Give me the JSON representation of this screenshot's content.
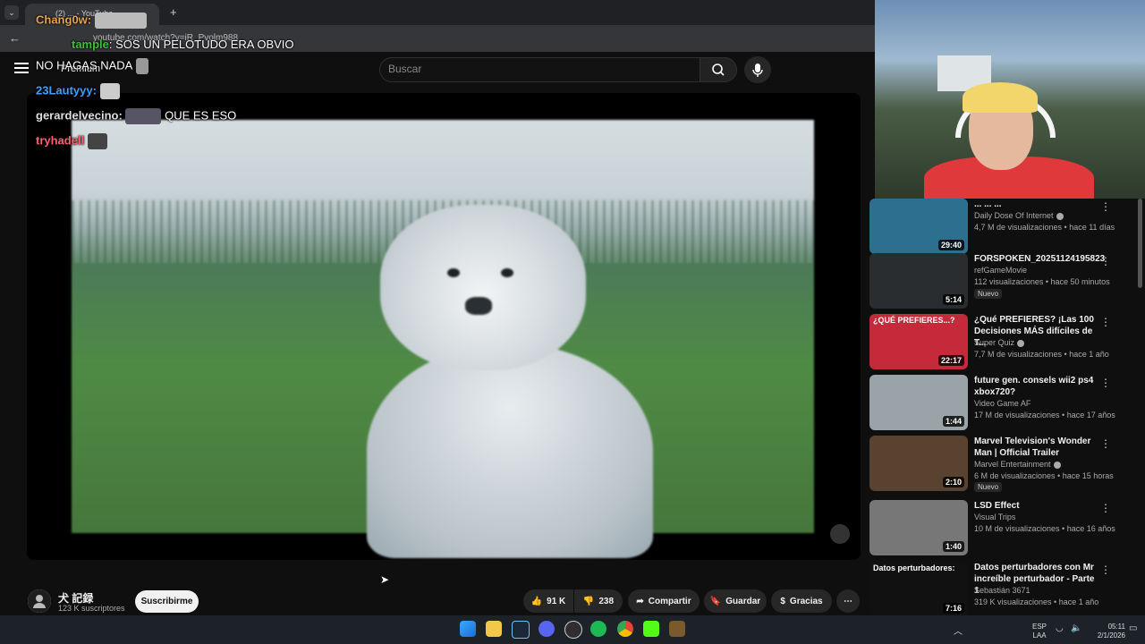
{
  "browser": {
    "tab_title": "(2) ... - YouTube",
    "url": "youtube.com/watch?v=iR_Pvolm988"
  },
  "search": {
    "placeholder": "Buscar"
  },
  "chat": [
    {
      "user": "Chang0w:",
      "color": "#e8a64a",
      "message": ""
    },
    {
      "user": "tample",
      "color": "#3fbf3f",
      "message": ": SOS UN PELOTUDO ERA OBVIO"
    },
    {
      "user": "",
      "color": "#ffffff",
      "message": "NO HAGAS NADA"
    },
    {
      "user": "23Lautyyy:",
      "color": "#3f9fff",
      "message": ""
    },
    {
      "user": "gerardelvecino:",
      "color": "#dddddd",
      "message": "QUE ES ESO"
    },
    {
      "user": "tryhadell",
      "color": "#ff5f6f",
      "message": ""
    }
  ],
  "premium_label": "Premium",
  "channel": {
    "name": "犬 記録",
    "subs": "123 K suscriptores",
    "subscribe_label": "Suscribirme"
  },
  "actions": {
    "likes": "91 K",
    "dislikes": "238",
    "share": "Compartir",
    "save": "Guardar",
    "thanks": "Gracias"
  },
  "recommendations": [
    {
      "title": "... ... ...",
      "channel": "Daily Dose Of Internet",
      "verified": true,
      "meta": "4,7 M de visualizaciones • hace 11 días",
      "duration": "29:40",
      "badge": "",
      "thumb": "#2d6f8f"
    },
    {
      "title": "FORSPOKEN_20251124195823",
      "channel": "refGameMovie",
      "verified": false,
      "meta": "112 visualizaciones • hace 50 minutos",
      "duration": "5:14",
      "badge": "Nuevo",
      "thumb": "#2a2d30"
    },
    {
      "title": "¿Qué PREFIERES? ¡Las 100 Decisiones MÁS difíciles de T...",
      "channel": "Super Quiz",
      "verified": true,
      "meta": "7,7 M de visualizaciones • hace 1 año",
      "duration": "22:17",
      "badge": "",
      "thumb": "#c42a3a",
      "thumb_text": "¿QUÉ PREFIERES...?"
    },
    {
      "title": "future gen. consels wii2 ps4 xbox720?",
      "channel": "Video Game AF",
      "verified": false,
      "meta": "17 M de visualizaciones • hace 17 años",
      "duration": "1:44",
      "badge": "",
      "thumb": "#9aa3a8"
    },
    {
      "title": "Marvel Television's Wonder Man | Official Trailer",
      "channel": "Marvel Entertainment",
      "verified": true,
      "meta": "6 M de visualizaciones • hace 15 horas",
      "duration": "2:10",
      "badge": "Nuevo",
      "thumb": "#5a4230"
    },
    {
      "title": "LSD Effect",
      "channel": "Visual Trips",
      "verified": false,
      "meta": "10 M de visualizaciones • hace 16 años",
      "duration": "1:40",
      "badge": "",
      "thumb": "#777777"
    },
    {
      "title": "Datos perturbadores con Mr increíble perturbador - Parte 1",
      "channel": "Sebastián 3671",
      "verified": false,
      "meta": "319 K visualizaciones • hace 1 año",
      "duration": "7:16",
      "badge": "",
      "thumb": "#111111",
      "thumb_text": "Datos perturbadores:"
    }
  ],
  "taskbar": {
    "lang": "ESP",
    "region": "LAA",
    "time": "05:11",
    "date": "2/1/2026"
  }
}
